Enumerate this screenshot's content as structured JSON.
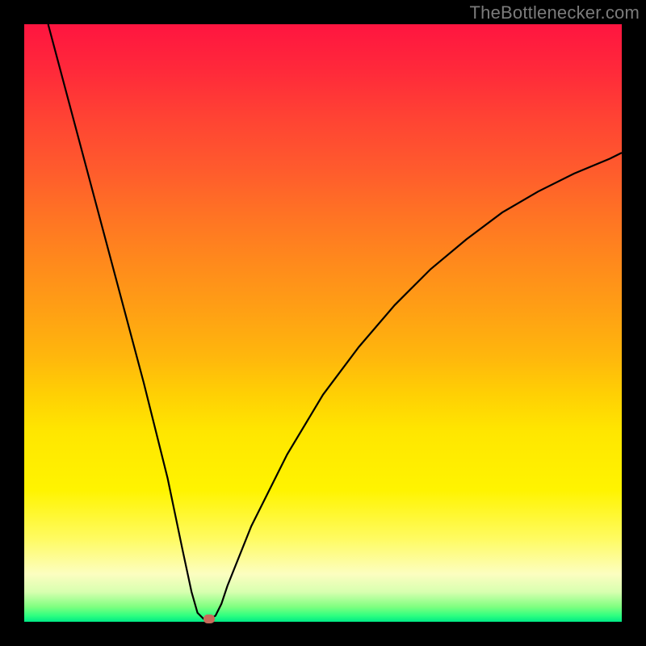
{
  "watermark": "TheBottlenecker.com",
  "chart_data": {
    "type": "line",
    "title": "",
    "xlabel": "",
    "ylabel": "",
    "xlim": [
      0,
      100
    ],
    "ylim": [
      0,
      100
    ],
    "x": [
      4,
      8,
      12,
      16,
      20,
      24,
      26.5,
      28,
      29,
      30,
      31,
      32,
      33,
      34,
      38,
      44,
      50,
      56,
      62,
      68,
      74,
      80,
      86,
      92,
      98,
      100
    ],
    "values": [
      100,
      85,
      70,
      55,
      40,
      24,
      12,
      5,
      1.5,
      0.5,
      0.5,
      1,
      3,
      6,
      16,
      28,
      38,
      46,
      53,
      59,
      64,
      68.5,
      72,
      75,
      77.5,
      78.5
    ],
    "marker": {
      "x": 31,
      "y": 0.6
    },
    "gradient_stops": [
      {
        "pos": 0.0,
        "color": "#ff1540"
      },
      {
        "pos": 0.5,
        "color": "#ffd000"
      },
      {
        "pos": 0.92,
        "color": "#fcfec0"
      },
      {
        "pos": 1.0,
        "color": "#00e885"
      }
    ]
  }
}
